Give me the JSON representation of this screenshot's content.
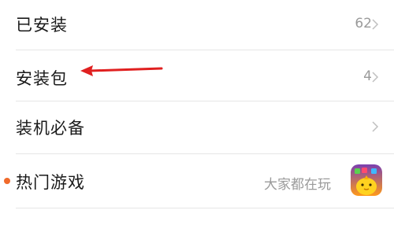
{
  "menu": {
    "installed": {
      "label": "已安装",
      "count": "62"
    },
    "packages": {
      "label": "安装包",
      "count": "4"
    },
    "essentials": {
      "label": "装机必备"
    },
    "hot_games": {
      "label": "热门游戏",
      "subtitle": "大家都在玩"
    }
  },
  "colors": {
    "accent_dot": "#f06a2b",
    "arrow": "#e02020",
    "text_primary": "#1a1a1a",
    "text_secondary": "#9a9a9a",
    "divider": "#e6e6e6"
  },
  "icons": {
    "chevron": "chevron-right-icon",
    "game": "game-app-icon",
    "annotation": "red-arrow-annotation"
  }
}
